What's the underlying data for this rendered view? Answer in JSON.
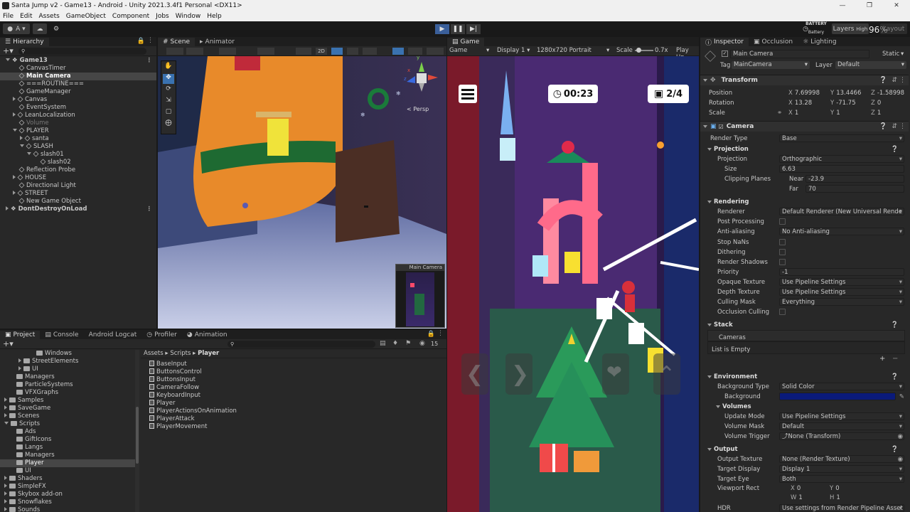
{
  "window": {
    "title": "Santa Jump v2 - Game13 - Android - Unity 2021.3.4f1 Personal <DX11>",
    "controls": [
      "—",
      "❐",
      "✕"
    ]
  },
  "menu": [
    "File",
    "Edit",
    "Assets",
    "GameObject",
    "Component",
    "Jobs",
    "Window",
    "Help"
  ],
  "toolbar": {
    "account": "A",
    "battery_label": "BATTERY",
    "battery_sub": "Battery",
    "battery_pct": "96%",
    "layers": "Layers",
    "quality": "High",
    "layout": "Layout"
  },
  "hierarchy": {
    "tab": "Hierarchy",
    "items": [
      {
        "label": "Game13",
        "level": 0,
        "type": "scene",
        "expanded": true,
        "selected": false
      },
      {
        "label": "CanvasTimer",
        "level": 1,
        "type": "obj"
      },
      {
        "label": "Main Camera",
        "level": 1,
        "type": "obj",
        "selected": true
      },
      {
        "label": "===ROUTINE===",
        "level": 1,
        "type": "obj"
      },
      {
        "label": "GameManager",
        "level": 1,
        "type": "obj"
      },
      {
        "label": "Canvas",
        "level": 1,
        "type": "obj",
        "collapsed": true
      },
      {
        "label": "EventSystem",
        "level": 1,
        "type": "obj"
      },
      {
        "label": "LeanLocalization",
        "level": 1,
        "type": "obj",
        "collapsed": true
      },
      {
        "label": "Volume",
        "level": 1,
        "type": "obj",
        "dim": true
      },
      {
        "label": "PLAYER",
        "level": 1,
        "type": "obj",
        "expanded": true
      },
      {
        "label": "santa",
        "level": 2,
        "type": "obj",
        "collapsed": true
      },
      {
        "label": "SLASH",
        "level": 2,
        "type": "obj",
        "expanded": true
      },
      {
        "label": "slash01",
        "level": 3,
        "type": "obj",
        "expanded": true
      },
      {
        "label": "slash02",
        "level": 4,
        "type": "obj"
      },
      {
        "label": "Reflection Probe",
        "level": 1,
        "type": "obj"
      },
      {
        "label": "HOUSE",
        "level": 1,
        "type": "obj",
        "collapsed": true
      },
      {
        "label": "Directional Light",
        "level": 1,
        "type": "obj"
      },
      {
        "label": "STREET",
        "level": 1,
        "type": "obj",
        "collapsed": true
      },
      {
        "label": "New Game Object",
        "level": 1,
        "type": "obj"
      },
      {
        "label": "DontDestroyOnLoad",
        "level": 0,
        "type": "scene",
        "collapsed": true
      }
    ]
  },
  "scene": {
    "tabs": [
      "Scene",
      "Animator"
    ],
    "mode_2d": "2D",
    "persp": "< Persp",
    "axis_x": "x",
    "axis_y": "y",
    "axis_z": "z",
    "preview_title": "Main Camera"
  },
  "game": {
    "tab": "Game",
    "mode": "Game",
    "display": "Display 1",
    "resolution": "1280x720 Portrait",
    "scale_label": "Scale",
    "scale_value": "0.7x",
    "play_label": "Play Un",
    "timer": "00:23",
    "gifts": "2/4"
  },
  "project": {
    "tabs": [
      "Project",
      "Console",
      "Android Logcat",
      "Profiler",
      "Animation"
    ],
    "count": "15",
    "breadcrumb": [
      "Assets",
      "Scripts",
      "Player"
    ],
    "tree": [
      {
        "label": "Windows",
        "level": 3
      },
      {
        "label": "StreetElements",
        "level": 2,
        "arrow": true
      },
      {
        "label": "UI",
        "level": 2,
        "arrow": true
      },
      {
        "label": "Managers",
        "level": 1
      },
      {
        "label": "ParticleSystems",
        "level": 1
      },
      {
        "label": "VFXGraphs",
        "level": 1
      },
      {
        "label": "Samples",
        "level": 0,
        "arrow": true
      },
      {
        "label": "SaveGame",
        "level": 0,
        "arrow": true
      },
      {
        "label": "Scenes",
        "level": 0,
        "arrow": true
      },
      {
        "label": "Scripts",
        "level": 0,
        "expanded": true
      },
      {
        "label": "Ads",
        "level": 1
      },
      {
        "label": "GiftIcons",
        "level": 1
      },
      {
        "label": "Langs",
        "level": 1
      },
      {
        "label": "Managers",
        "level": 1
      },
      {
        "label": "Player",
        "level": 1,
        "selected": true
      },
      {
        "label": "UI",
        "level": 1
      },
      {
        "label": "Shaders",
        "level": 0,
        "arrow": true
      },
      {
        "label": "SimpleFX",
        "level": 0,
        "arrow": true
      },
      {
        "label": "Skybox add-on",
        "level": 0,
        "arrow": true
      },
      {
        "label": "Snowflakes",
        "level": 0,
        "arrow": true
      },
      {
        "label": "Sounds",
        "level": 0,
        "arrow": true
      }
    ],
    "files": [
      "BaseInput",
      "ButtonsControl",
      "ButtonsInput",
      "CameraFollow",
      "KeyboardInput",
      "Player",
      "PlayerActionsOnAnimation",
      "PlayerAttack",
      "PlayerMovement"
    ]
  },
  "inspector": {
    "tabs": [
      "Inspector",
      "Occlusion",
      "Lighting"
    ],
    "object_name": "Main Camera",
    "static_label": "Static",
    "tag_label": "Tag",
    "tag_value": "MainCamera",
    "layer_label": "Layer",
    "layer_value": "Default",
    "transform": {
      "header": "Transform",
      "position_label": "Position",
      "position": {
        "x": "7.69998",
        "y": "13.4466",
        "z": "-1.58998"
      },
      "rotation_label": "Rotation",
      "rotation": {
        "x": "13.28",
        "y": "-71.75",
        "z": "0"
      },
      "scale_label": "Scale",
      "scale": {
        "x": "1",
        "y": "1",
        "z": "1"
      }
    },
    "camera": {
      "header": "Camera",
      "render_type_label": "Render Type",
      "render_type": "Base",
      "projection_section": "Projection",
      "projection_label": "Projection",
      "projection": "Orthographic",
      "size_label": "Size",
      "size": "6.63",
      "clipping_label": "Clipping Planes",
      "near_label": "Near",
      "near": "-23.9",
      "far_label": "Far",
      "far": "70",
      "rendering_section": "Rendering",
      "renderer_label": "Renderer",
      "renderer": "Default Renderer (New Universal Rende",
      "post_label": "Post Processing",
      "aa_label": "Anti-aliasing",
      "aa": "No Anti-aliasing",
      "stopnans_label": "Stop NaNs",
      "dither_label": "Dithering",
      "shadows_label": "Render Shadows",
      "priority_label": "Priority",
      "priority": "-1",
      "opaque_label": "Opaque Texture",
      "opaque": "Use Pipeline Settings",
      "depth_label": "Depth Texture",
      "depth": "Use Pipeline Settings",
      "culling_label": "Culling Mask",
      "culling": "Everything",
      "occlusion_label": "Occlusion Culling",
      "stack_section": "Stack",
      "cameras_label": "Cameras",
      "list_empty": "List is Empty",
      "plus": "+",
      "minus": "−",
      "env_section": "Environment",
      "bgtype_label": "Background Type",
      "bgtype": "Solid Color",
      "bg_label": "Background",
      "bg_color": "#0a1a7a",
      "volumes_section": "Volumes",
      "update_label": "Update Mode",
      "update": "Use Pipeline Settings",
      "vmask_label": "Volume Mask",
      "vmask": "Default",
      "vtrigger_label": "Volume Trigger",
      "vtrigger": "⤴None (Transform)",
      "output_section": "Output",
      "otex_label": "Output Texture",
      "otex": "None (Render Texture)",
      "tdisp_label": "Target Display",
      "tdisp": "Display 1",
      "teye_label": "Target Eye",
      "teye": "Both",
      "vrect_label": "Viewport Rect",
      "vrect": {
        "x": "0",
        "y": "0",
        "w": "1",
        "h": "1"
      },
      "hdr_label": "HDR",
      "hdr": "Use settings from Render Pipeline Asset"
    }
  },
  "colors": {
    "accent": "#3a72b0",
    "selected": "#464646",
    "play_active": "#3a5f9a"
  }
}
